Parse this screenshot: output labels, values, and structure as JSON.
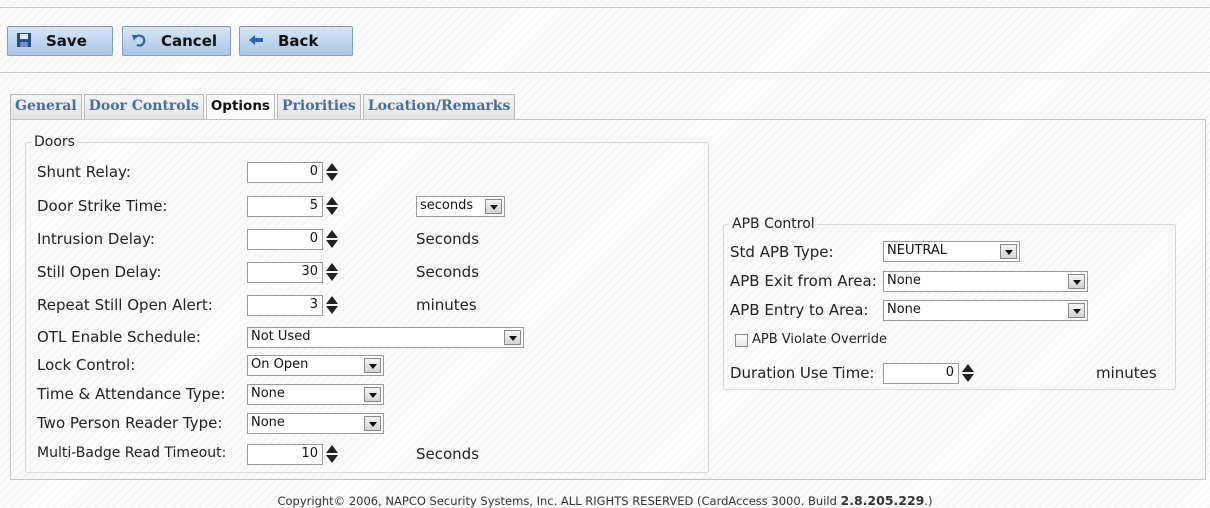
{
  "toolbar": {
    "save_label": "Save",
    "cancel_label": "Cancel",
    "back_label": "Back"
  },
  "tabs": [
    {
      "label": "General"
    },
    {
      "label": "Door Controls"
    },
    {
      "label": "Options",
      "active": true
    },
    {
      "label": "Priorities"
    },
    {
      "label": "Location/Remarks"
    }
  ],
  "doors": {
    "legend": "Doors",
    "shunt_relay": {
      "label": "Shunt Relay:",
      "value": "0"
    },
    "door_strike_time": {
      "label": "Door Strike Time:",
      "value": "5",
      "unit": "seconds"
    },
    "intrusion_delay": {
      "label": "Intrusion Delay:",
      "value": "0",
      "unit": "Seconds"
    },
    "still_open_delay": {
      "label": "Still Open Delay:",
      "value": "30",
      "unit": "Seconds"
    },
    "repeat_still_open_alert": {
      "label": "Repeat Still Open Alert:",
      "value": "3",
      "unit": "minutes"
    },
    "otl_enable_schedule": {
      "label": "OTL Enable Schedule:",
      "value": "Not Used"
    },
    "lock_control": {
      "label": "Lock Control:",
      "value": "On Open"
    },
    "time_attendance_type": {
      "label": "Time & Attendance Type:",
      "value": "None"
    },
    "two_person_reader_type": {
      "label": "Two Person Reader Type:",
      "value": "None"
    },
    "multi_badge_read_timeout": {
      "label": "Multi-Badge Read Timeout:",
      "value": "10",
      "unit": "Seconds"
    }
  },
  "apb": {
    "legend": "APB Control",
    "std_apb_type": {
      "label": "Std APB Type:",
      "value": "NEUTRAL"
    },
    "exit_from_area": {
      "label": "APB Exit from Area:",
      "value": "None"
    },
    "entry_to_area": {
      "label": "APB Entry to Area:",
      "value": "None"
    },
    "violate_override": {
      "label": "APB Violate Override",
      "checked": false
    },
    "duration_use_time": {
      "label": "Duration Use Time:",
      "value": "0",
      "unit": "minutes"
    }
  },
  "footer": {
    "text": "Copyright© 2006, NAPCO Security Systems, Inc. ALL RIGHTS RESERVED (CardAccess 3000. Build ",
    "build": "2.8.205.229",
    "end": ".)"
  },
  "colors": {
    "button_gradient_top": "#d7e6f6",
    "button_gradient_bottom": "#a9c5e6",
    "tab_text": "#4a6f96"
  }
}
